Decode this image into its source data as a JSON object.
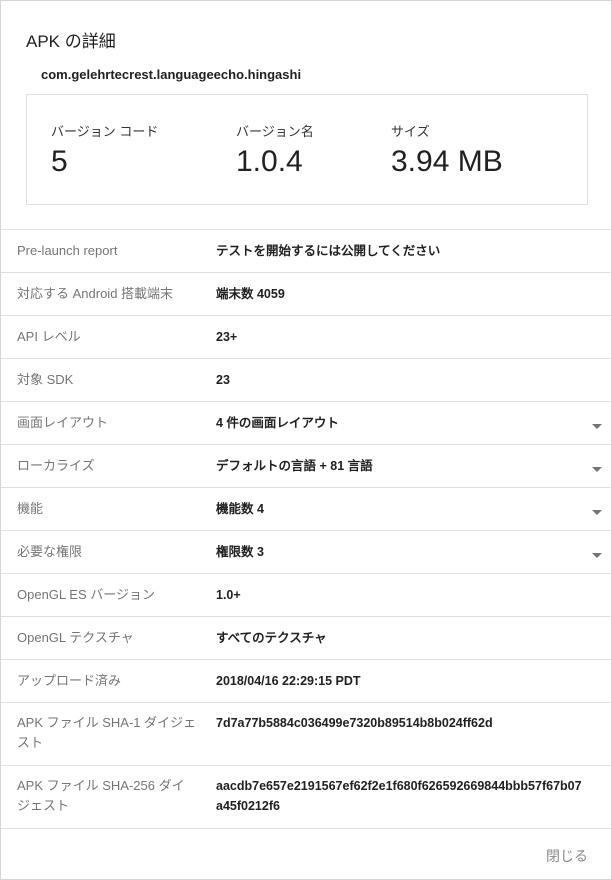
{
  "dialog": {
    "title": "APK の詳細",
    "package_name": "com.gelehrtecrest.languageecho.hingashi",
    "stats": [
      {
        "label": "バージョン コード",
        "value": "5"
      },
      {
        "label": "バージョン名",
        "value": "1.0.4"
      },
      {
        "label": "サイズ",
        "value": "3.94 MB"
      }
    ],
    "rows": [
      {
        "label": "Pre-launch report",
        "value": "テストを開始するには公開してください",
        "expandable": false
      },
      {
        "label": "対応する Android 搭載端末",
        "value": "端末数 4059",
        "expandable": false
      },
      {
        "label": "API レベル",
        "value": "23+",
        "expandable": false
      },
      {
        "label": "対象 SDK",
        "value": "23",
        "expandable": false
      },
      {
        "label": "画面レイアウト",
        "value": "4 件の画面レイアウト",
        "expandable": true
      },
      {
        "label": "ローカライズ",
        "value": "デフォルトの言語 + 81 言語",
        "expandable": true
      },
      {
        "label": "機能",
        "value": "機能数 4",
        "expandable": true
      },
      {
        "label": "必要な権限",
        "value": "権限数 3",
        "expandable": true
      },
      {
        "label": "OpenGL ES バージョン",
        "value": "1.0+",
        "expandable": false
      },
      {
        "label": "OpenGL テクスチャ",
        "value": "すべてのテクスチャ",
        "expandable": false
      },
      {
        "label": "アップロード済み",
        "value": "2018/04/16 22:29:15 PDT",
        "expandable": false
      },
      {
        "label": "APK ファイル SHA-1 ダイジェスト",
        "value": "7d7a77b5884c036499e7320b89514b8b024ff62d",
        "expandable": false
      },
      {
        "label": "APK ファイル SHA-256 ダイジェスト",
        "value": "aacdb7e657e2191567ef62f2e1f680f626592669844bbb57f67b07a45f0212f6",
        "expandable": false
      }
    ],
    "close_label": "閉じる"
  }
}
